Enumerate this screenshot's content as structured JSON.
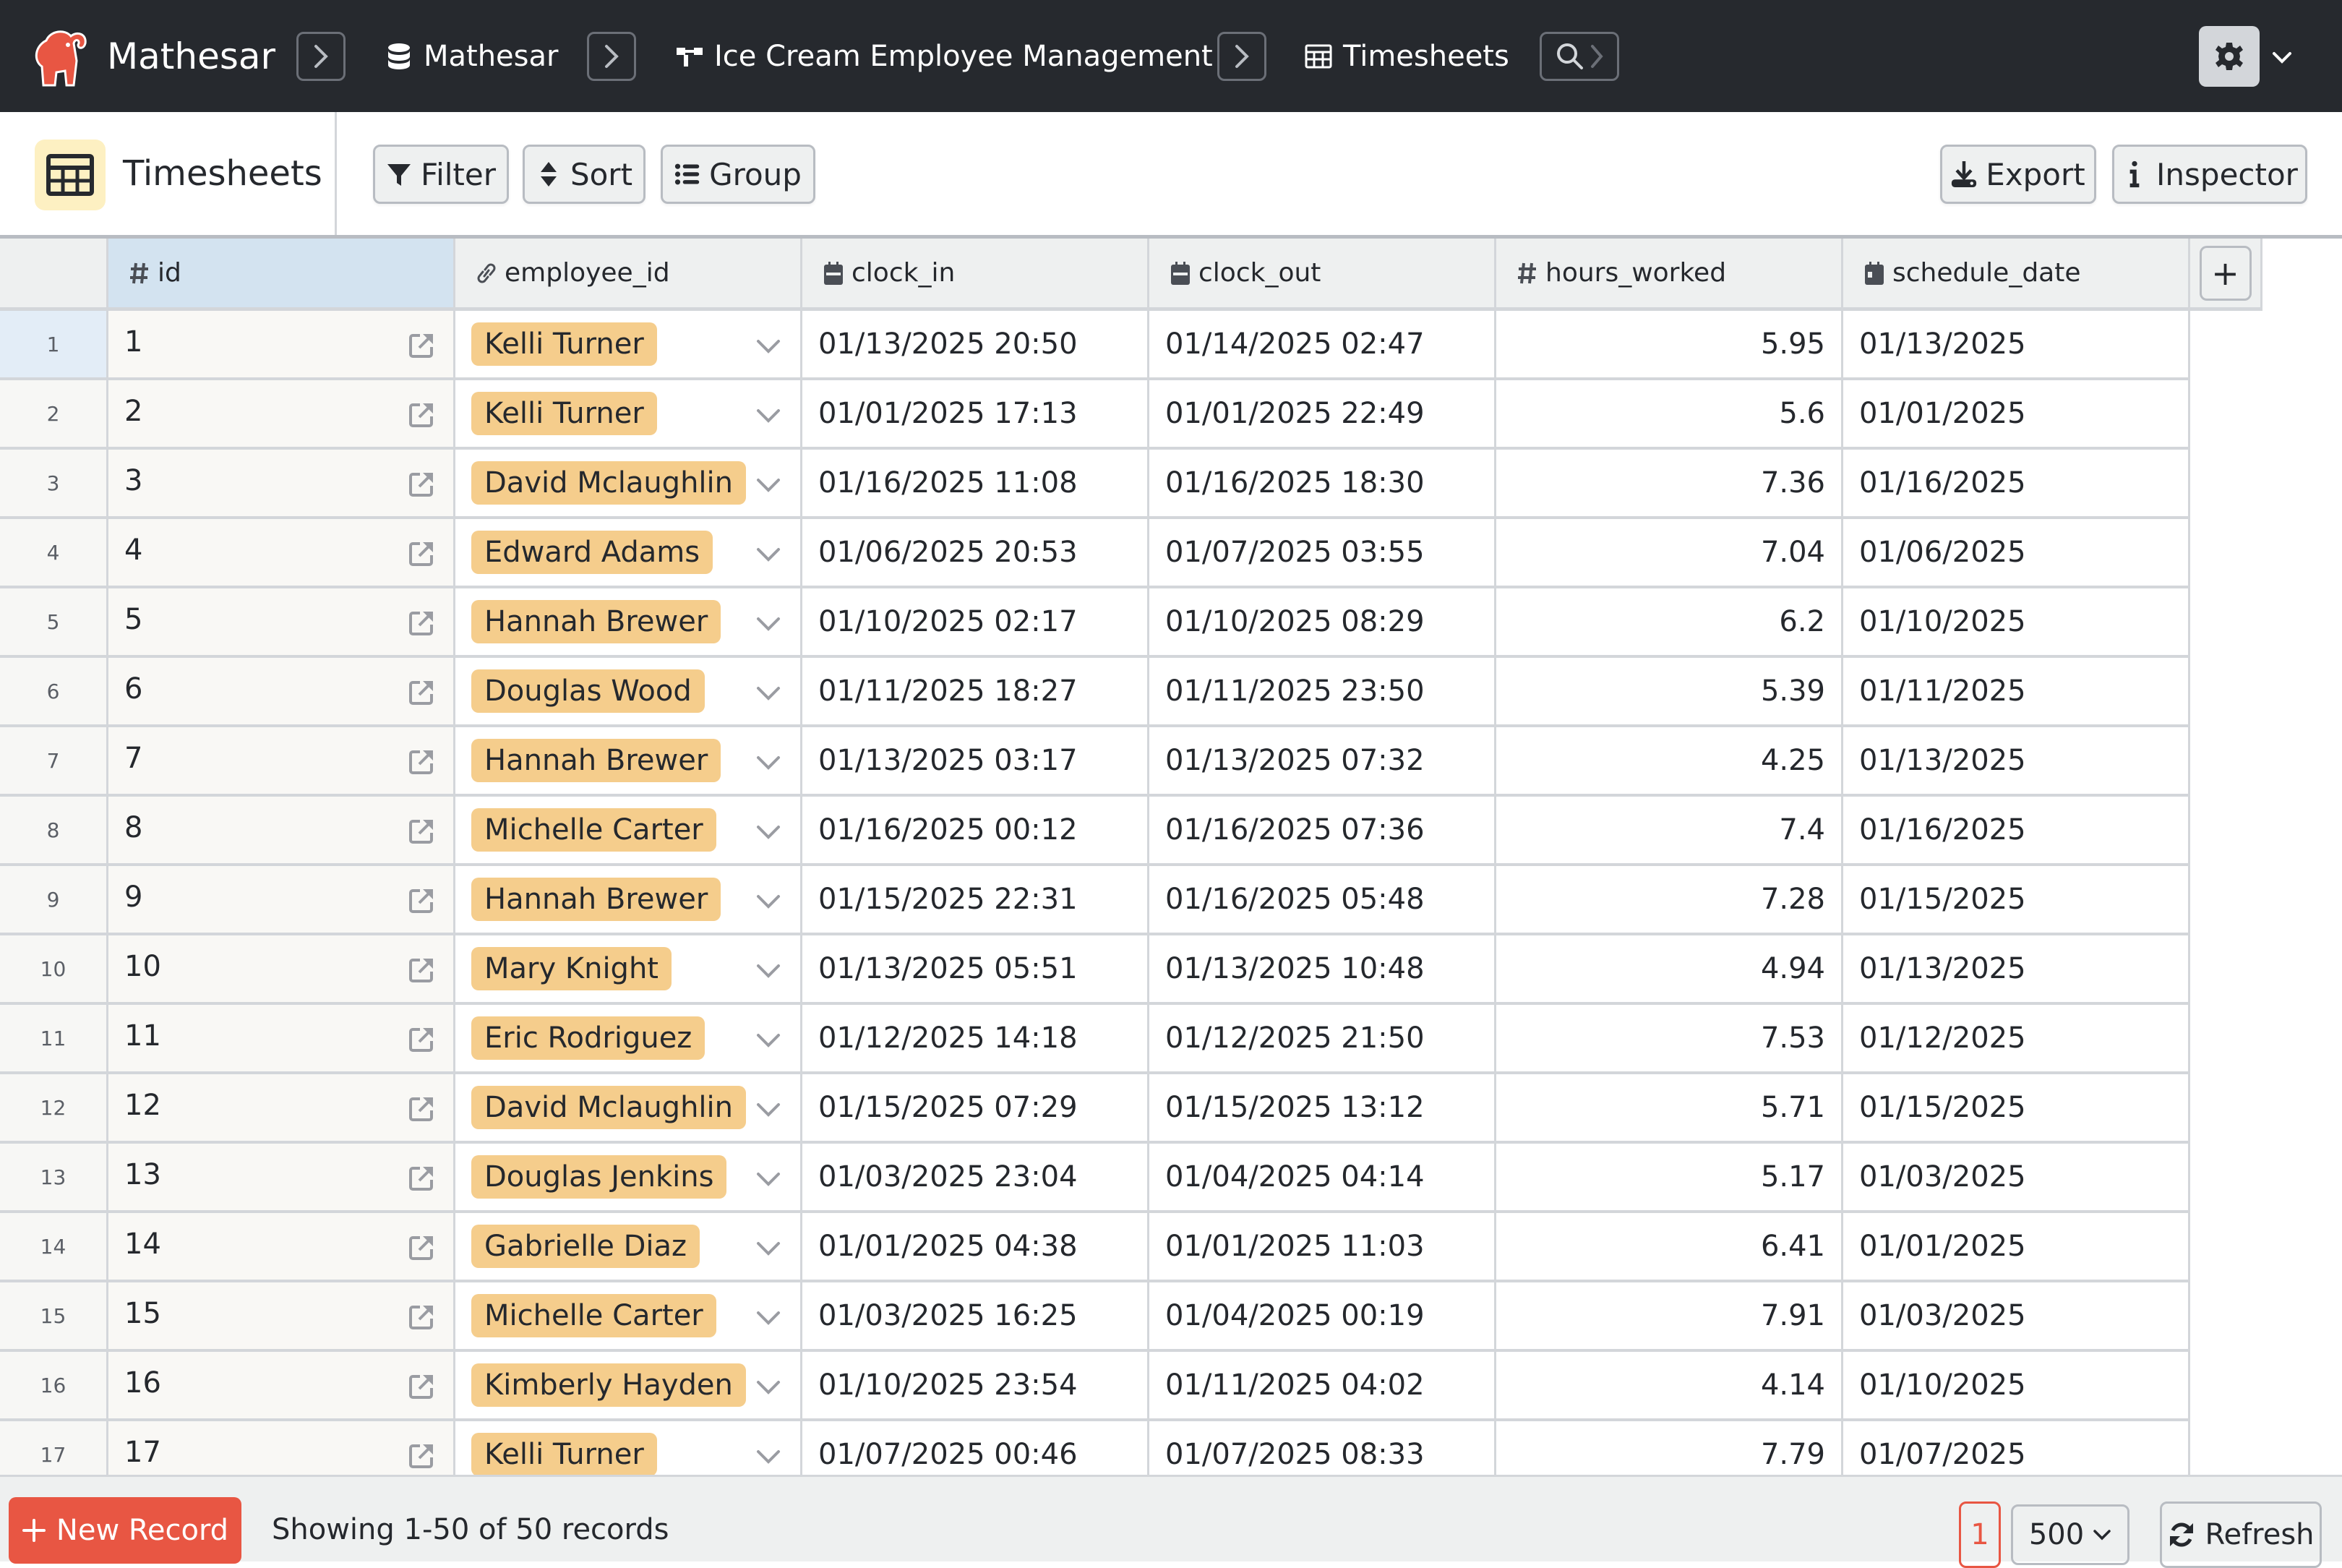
{
  "nav": {
    "brand": "Mathesar",
    "breadcrumbs": [
      {
        "label": "Mathesar",
        "icon": "database-icon"
      },
      {
        "label": "Ice Cream Employee Management",
        "icon": "schema-icon"
      },
      {
        "label": "Timesheets",
        "icon": "table-icon"
      }
    ]
  },
  "toolbar": {
    "table_name": "Timesheets",
    "filter_label": "Filter",
    "sort_label": "Sort",
    "group_label": "Group",
    "export_label": "Export",
    "inspector_label": "Inspector"
  },
  "columns": [
    {
      "name": "id",
      "icon": "hash-icon"
    },
    {
      "name": "employee_id",
      "icon": "link-icon"
    },
    {
      "name": "clock_in",
      "icon": "calendar-icon"
    },
    {
      "name": "clock_out",
      "icon": "calendar-icon"
    },
    {
      "name": "hours_worked",
      "icon": "hash-icon"
    },
    {
      "name": "schedule_date",
      "icon": "calendar-icon"
    }
  ],
  "add_column_label": "+",
  "rows": [
    {
      "num": "1",
      "id": "1",
      "employee": "Kelli Turner",
      "clock_in": "01/13/2025 20:50",
      "clock_out": "01/14/2025 02:47",
      "hours": "5.95",
      "date": "01/13/2025"
    },
    {
      "num": "2",
      "id": "2",
      "employee": "Kelli Turner",
      "clock_in": "01/01/2025 17:13",
      "clock_out": "01/01/2025 22:49",
      "hours": "5.6",
      "date": "01/01/2025"
    },
    {
      "num": "3",
      "id": "3",
      "employee": "David Mclaughlin",
      "clock_in": "01/16/2025 11:08",
      "clock_out": "01/16/2025 18:30",
      "hours": "7.36",
      "date": "01/16/2025"
    },
    {
      "num": "4",
      "id": "4",
      "employee": "Edward Adams",
      "clock_in": "01/06/2025 20:53",
      "clock_out": "01/07/2025 03:55",
      "hours": "7.04",
      "date": "01/06/2025"
    },
    {
      "num": "5",
      "id": "5",
      "employee": "Hannah Brewer",
      "clock_in": "01/10/2025 02:17",
      "clock_out": "01/10/2025 08:29",
      "hours": "6.2",
      "date": "01/10/2025"
    },
    {
      "num": "6",
      "id": "6",
      "employee": "Douglas Wood",
      "clock_in": "01/11/2025 18:27",
      "clock_out": "01/11/2025 23:50",
      "hours": "5.39",
      "date": "01/11/2025"
    },
    {
      "num": "7",
      "id": "7",
      "employee": "Hannah Brewer",
      "clock_in": "01/13/2025 03:17",
      "clock_out": "01/13/2025 07:32",
      "hours": "4.25",
      "date": "01/13/2025"
    },
    {
      "num": "8",
      "id": "8",
      "employee": "Michelle Carter",
      "clock_in": "01/16/2025 00:12",
      "clock_out": "01/16/2025 07:36",
      "hours": "7.4",
      "date": "01/16/2025"
    },
    {
      "num": "9",
      "id": "9",
      "employee": "Hannah Brewer",
      "clock_in": "01/15/2025 22:31",
      "clock_out": "01/16/2025 05:48",
      "hours": "7.28",
      "date": "01/15/2025"
    },
    {
      "num": "10",
      "id": "10",
      "employee": "Mary Knight",
      "clock_in": "01/13/2025 05:51",
      "clock_out": "01/13/2025 10:48",
      "hours": "4.94",
      "date": "01/13/2025"
    },
    {
      "num": "11",
      "id": "11",
      "employee": "Eric Rodriguez",
      "clock_in": "01/12/2025 14:18",
      "clock_out": "01/12/2025 21:50",
      "hours": "7.53",
      "date": "01/12/2025"
    },
    {
      "num": "12",
      "id": "12",
      "employee": "David Mclaughlin",
      "clock_in": "01/15/2025 07:29",
      "clock_out": "01/15/2025 13:12",
      "hours": "5.71",
      "date": "01/15/2025"
    },
    {
      "num": "13",
      "id": "13",
      "employee": "Douglas Jenkins",
      "clock_in": "01/03/2025 23:04",
      "clock_out": "01/04/2025 04:14",
      "hours": "5.17",
      "date": "01/03/2025"
    },
    {
      "num": "14",
      "id": "14",
      "employee": "Gabrielle Diaz",
      "clock_in": "01/01/2025 04:38",
      "clock_out": "01/01/2025 11:03",
      "hours": "6.41",
      "date": "01/01/2025"
    },
    {
      "num": "15",
      "id": "15",
      "employee": "Michelle Carter",
      "clock_in": "01/03/2025 16:25",
      "clock_out": "01/04/2025 00:19",
      "hours": "7.91",
      "date": "01/03/2025"
    },
    {
      "num": "16",
      "id": "16",
      "employee": "Kimberly Hayden",
      "clock_in": "01/10/2025 23:54",
      "clock_out": "01/11/2025 04:02",
      "hours": "4.14",
      "date": "01/10/2025"
    },
    {
      "num": "17",
      "id": "17",
      "employee": "Kelli Turner",
      "clock_in": "01/07/2025 00:46",
      "clock_out": "01/07/2025 08:33",
      "hours": "7.79",
      "date": "01/07/2025"
    }
  ],
  "footer": {
    "new_record_label": "New Record",
    "records_text": "Showing 1-50 of 50 records",
    "current_page": "1",
    "page_size": "500",
    "refresh_label": "Refresh"
  },
  "colors": {
    "accent": "#e85643",
    "topbar": "#26292e",
    "pill": "#f5cd8c",
    "selected_column": "#d3e3f0"
  }
}
